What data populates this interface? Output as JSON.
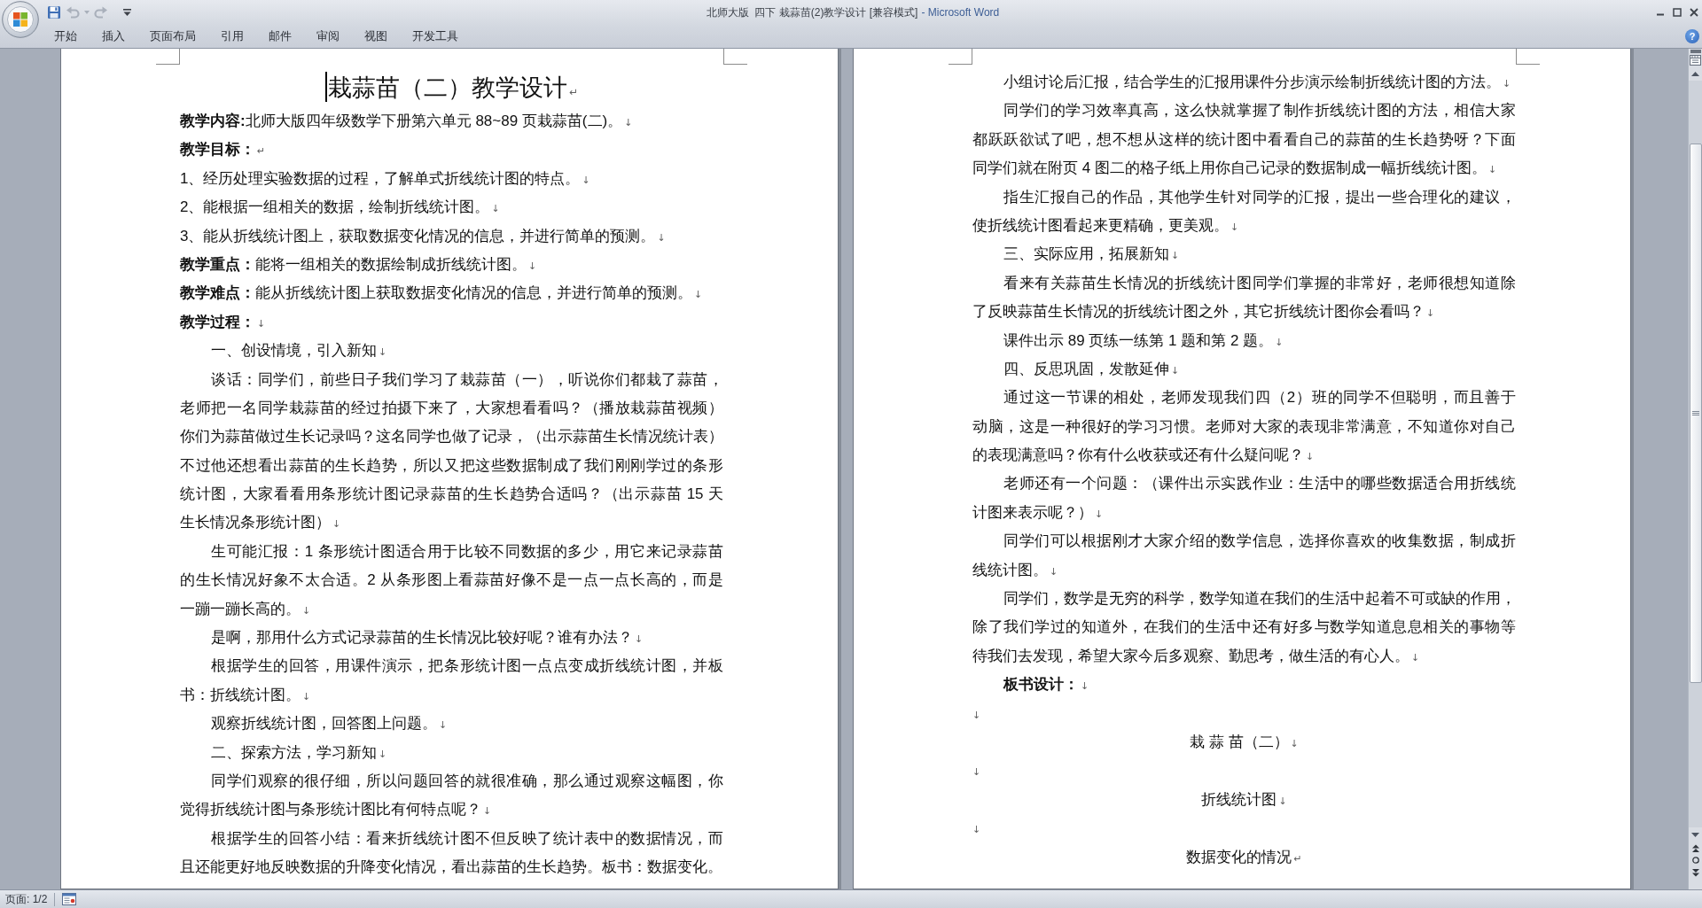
{
  "window": {
    "title": "北师大版  四下 栽蒜苗(2)教学设计 [兼容模式]",
    "app_name": "- Microsoft Word"
  },
  "quick_access": [
    {
      "kind": "save",
      "disabled": false
    },
    {
      "kind": "undo",
      "disabled": true
    },
    {
      "kind": "dropdown",
      "disabled": true
    },
    {
      "kind": "redo",
      "disabled": true
    },
    {
      "kind": "customize",
      "disabled": false
    }
  ],
  "ribbon": {
    "tabs": [
      {
        "label": "开始",
        "selected": false
      },
      {
        "label": "插入",
        "selected": false
      },
      {
        "label": "页面布局",
        "selected": false
      },
      {
        "label": "引用",
        "selected": false
      },
      {
        "label": "邮件",
        "selected": false
      },
      {
        "label": "审阅",
        "selected": false
      },
      {
        "label": "视图",
        "selected": false
      },
      {
        "label": "开发工具",
        "selected": false
      }
    ],
    "help": "?"
  },
  "pages": [
    {
      "title": {
        "text": "栽蒜苗（二）教学设计",
        "cursor": true,
        "end_mark": "↵"
      },
      "paragraphs": [
        {
          "kind": "flush",
          "bold": false,
          "lines": [
            "**教学内容:**北师大版四年级数学下册第六单元 88~89 页栽蒜苗(二)。"
          ],
          "end_mark": "↓"
        },
        {
          "kind": "flush",
          "bold": true,
          "lines": [
            "教学目标："
          ],
          "end_mark": "↵"
        },
        {
          "kind": "flush",
          "bold": false,
          "lines": [
            "1、经历处理实验数据的过程，了解单式折线统计图的特点。"
          ],
          "end_mark": "↓"
        },
        {
          "kind": "flush",
          "bold": false,
          "lines": [
            "2、能根据一组相关的数据，绘制折线统计图。"
          ],
          "end_mark": "↓"
        },
        {
          "kind": "flush",
          "bold": false,
          "lines": [
            "3、能从折线统计图上，获取数据变化情况的信息，并进行简单的预测。"
          ],
          "end_mark": "↓"
        },
        {
          "kind": "flush",
          "bold": false,
          "lines": [
            "**教学重点：**能将一组相关的数据绘制成折线统计图。"
          ],
          "end_mark": "↓"
        },
        {
          "kind": "flush",
          "bold": false,
          "lines": [
            "**教学难点：**能从折线统计图上获取数据变化情况的信息，并进行简单的预测。"
          ],
          "end_mark": "↓"
        },
        {
          "kind": "flush",
          "bold": true,
          "lines": [
            "教学过程："
          ],
          "end_mark": "↓"
        },
        {
          "kind": "indented",
          "bold": false,
          "lines": [
            "一、创设情境，引入新知"
          ],
          "end_mark": "↓"
        },
        {
          "kind": "indented",
          "bold": false,
          "lines": [
            "谈话：同学们，前些日子我们学习了栽蒜苗（一），听说你们都栽了蒜苗，",
            "老师把一名同学栽蒜苗的经过拍摄下来了，大家想看看吗？（播放栽蒜苗视频）",
            "你们为蒜苗做过生长记录吗？这名同学也做了记录，（出示蒜苗生长情况统计表）",
            "不过他还想看出蒜苗的生长趋势，所以又把这些数据制成了我们刚刚学过的条形",
            "统计图，大家看看用条形统计图记录蒜苗的生长趋势合适吗？（出示蒜苗 15 天",
            "生长情况条形统计图）"
          ],
          "end_mark": "↓"
        },
        {
          "kind": "indented",
          "bold": false,
          "lines": [
            "生可能汇报：1 条形统计图适合用于比较不同数据的多少，用它来记录蒜苗",
            "的生长情况好象不太合适。2 从条形图上看蒜苗好像不是一点一点长高的，而是",
            "一蹦一蹦长高的。"
          ],
          "end_mark": "↓"
        },
        {
          "kind": "indented",
          "bold": false,
          "lines": [
            "是啊，那用什么方式记录蒜苗的生长情况比较好呢？谁有办法？"
          ],
          "end_mark": "↓"
        },
        {
          "kind": "indented",
          "bold": false,
          "lines": [
            "根据学生的回答，用课件演示，把条形统计图一点点变成折线统计图，并板",
            "书：折线统计图。"
          ],
          "end_mark": "↓"
        },
        {
          "kind": "indented",
          "bold": false,
          "lines": [
            "观察折线统计图，回答图上问题。"
          ],
          "end_mark": "↓"
        },
        {
          "kind": "indented",
          "bold": false,
          "lines": [
            "二、探索方法，学习新知"
          ],
          "end_mark": "↓"
        },
        {
          "kind": "indented",
          "bold": false,
          "lines": [
            "同学们观察的很仔细，所以问题回答的就很准确，那么通过观察这幅图，你",
            "觉得折线统计图与条形统计图比有何特点呢？"
          ],
          "end_mark": "↓"
        },
        {
          "kind": "indented",
          "bold": false,
          "lines": [
            "根据学生的回答小结：看来折线统计图不但反映了统计表中的数据情况，而",
            "且还能更好地反映数据的升降变化情况，看出蒜苗的生长趋势。板书：数据变化。"
          ]
        }
      ]
    },
    {
      "paragraphs": [
        {
          "kind": "indented",
          "bold": false,
          "lines": [
            "小组讨论后汇报，结合学生的汇报用课件分步演示绘制折线统计图的方法。"
          ],
          "end_mark": "↓"
        },
        {
          "kind": "indented",
          "bold": false,
          "lines": [
            "同学们的学习效率真高，这么快就掌握了制作折线统计图的方法，相信大家",
            "都跃跃欲试了吧，想不想从这样的统计图中看看自己的蒜苗的生长趋势呀？下面",
            "同学们就在附页 4 图二的格子纸上用你自己记录的数据制成一幅折线统计图。"
          ],
          "end_mark": "↓"
        },
        {
          "kind": "indented",
          "bold": false,
          "lines": [
            "指生汇报自己的作品，其他学生针对同学的汇报，提出一些合理化的建议，",
            "使折线统计图看起来更精确，更美观。"
          ],
          "end_mark": "↓"
        },
        {
          "kind": "indented",
          "bold": false,
          "lines": [
            "三、实际应用，拓展新知"
          ],
          "end_mark": "↓"
        },
        {
          "kind": "indented",
          "bold": false,
          "lines": [
            "看来有关蒜苗生长情况的折线统计图同学们掌握的非常好，老师很想知道除",
            "了反映蒜苗生长情况的折线统计图之外，其它折线统计图你会看吗？"
          ],
          "end_mark": "↓"
        },
        {
          "kind": "indented",
          "bold": false,
          "lines": [
            "课件出示 89 页练一练第 1 题和第 2 题。"
          ],
          "end_mark": "↓"
        },
        {
          "kind": "indented",
          "bold": false,
          "lines": [
            "四、反思巩固，发散延伸"
          ],
          "end_mark": "↓"
        },
        {
          "kind": "indented",
          "bold": false,
          "lines": [
            "通过这一节课的相处，老师发现我们四（2）班的同学不但聪明，而且善于",
            "动脑，这是一种很好的学习习惯。老师对大家的表现非常满意，不知道你对自己",
            "的表现满意吗？你有什么收获或还有什么疑问呢？"
          ],
          "end_mark": "↓"
        },
        {
          "kind": "indented",
          "bold": false,
          "lines": [
            "老师还有一个问题：（课件出示实践作业：生活中的哪些数据适合用折线统",
            "计图来表示呢？）"
          ],
          "end_mark": "↓"
        },
        {
          "kind": "indented",
          "bold": false,
          "lines": [
            "同学们可以根据刚才大家介绍的数学信息，选择你喜欢的收集数据，制成折",
            "线统计图。"
          ],
          "end_mark": "↓"
        },
        {
          "kind": "indented",
          "bold": false,
          "lines": [
            "同学们，数学是无穷的科学，数学知道在我们的生活中起着不可或缺的作用，",
            "除了我们学过的知道外，在我们的生活中还有好多与数学知道息息相关的事物等",
            "待我们去发现，希望大家今后多观察、勤思考，做生活的有心人。"
          ],
          "end_mark": "↓"
        },
        {
          "kind": "indented",
          "bold": true,
          "lines": [
            "板书设计："
          ],
          "end_mark": "↓"
        },
        {
          "kind": "blank",
          "end_mark": "↓"
        },
        {
          "kind": "centered",
          "bold": false,
          "lines": [
            "栽 蒜 苗（二）"
          ],
          "end_mark": "↓"
        },
        {
          "kind": "blank",
          "end_mark": "↓"
        },
        {
          "kind": "centered",
          "bold": false,
          "lines": [
            "折线统计图"
          ],
          "end_mark": "↓"
        },
        {
          "kind": "blank",
          "end_mark": "↓"
        },
        {
          "kind": "centered",
          "bold": false,
          "lines": [
            "数据变化的情况"
          ],
          "end_mark": "↵"
        }
      ]
    }
  ],
  "status_bar": {
    "page": "页面: 1/2"
  }
}
